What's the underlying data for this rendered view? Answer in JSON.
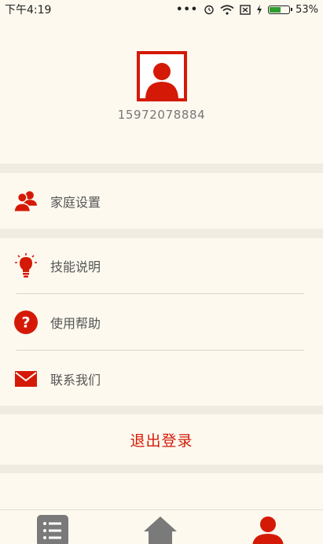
{
  "status_bar": {
    "time": "下午4:19",
    "battery": "53%"
  },
  "profile": {
    "phone": "15972078884"
  },
  "menu": {
    "family_settings": {
      "label": "家庭设置",
      "icon": "users-icon"
    },
    "skills": {
      "label": "技能说明",
      "icon": "lightbulb-icon"
    },
    "help": {
      "label": "使用帮助",
      "icon": "question-icon"
    },
    "contact": {
      "label": "联系我们",
      "icon": "envelope-icon"
    }
  },
  "logout_label": "退出登录",
  "bottom_nav": {
    "items": [
      {
        "icon": "list-icon"
      },
      {
        "icon": "home-icon"
      },
      {
        "icon": "user-icon",
        "active": true
      }
    ]
  },
  "colors": {
    "accent": "#d41a06",
    "background": "#fdf9ef",
    "band": "#f1ece2",
    "inactive_nav": "#7a7a7a"
  }
}
